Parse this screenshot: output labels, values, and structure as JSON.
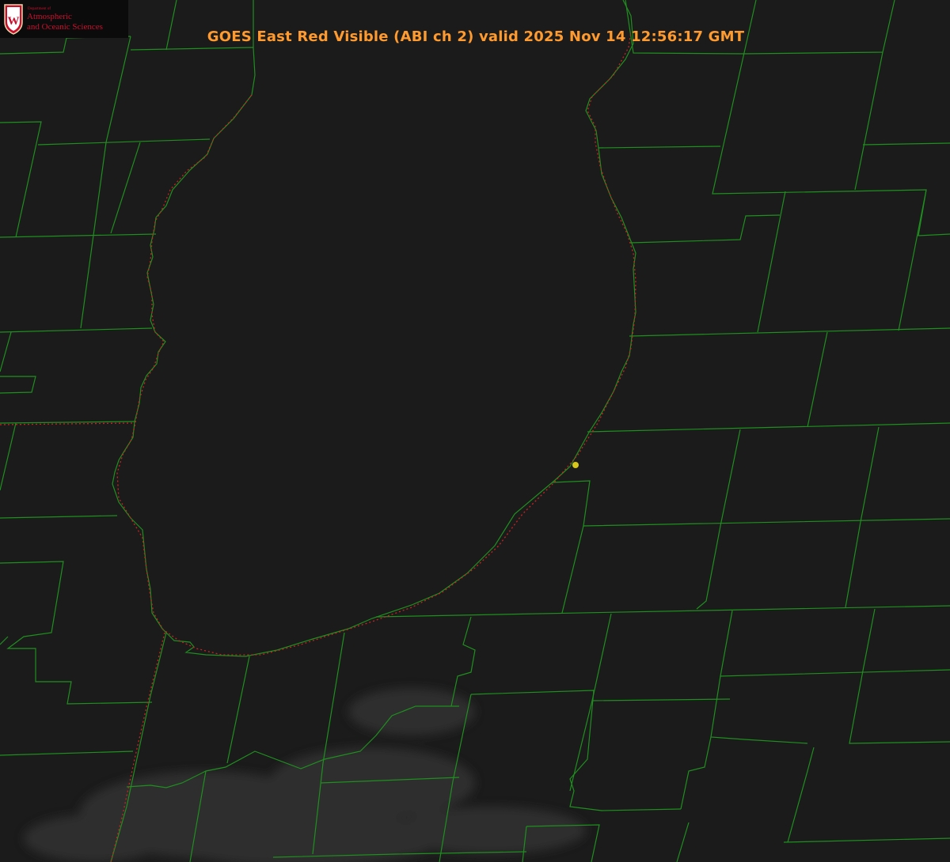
{
  "title": "GOES East Red Visible (ABI ch 2) valid 2025 Nov 14 12:56:17 GMT",
  "logo": {
    "dept_line": "Department of",
    "line1": "Atmospheric",
    "line2": "and Oceanic Sciences",
    "crest_letter": "W"
  },
  "colors": {
    "background": "#1b1b1b",
    "county_lines": "#1f8f1f",
    "state_lines": "#cc2222",
    "title": "#ff9a2e",
    "marker": "#d8c81a",
    "logo_text": "#c8102e"
  },
  "icons": {
    "crest": "uw-crest-icon",
    "marker": "location-dot-icon"
  }
}
